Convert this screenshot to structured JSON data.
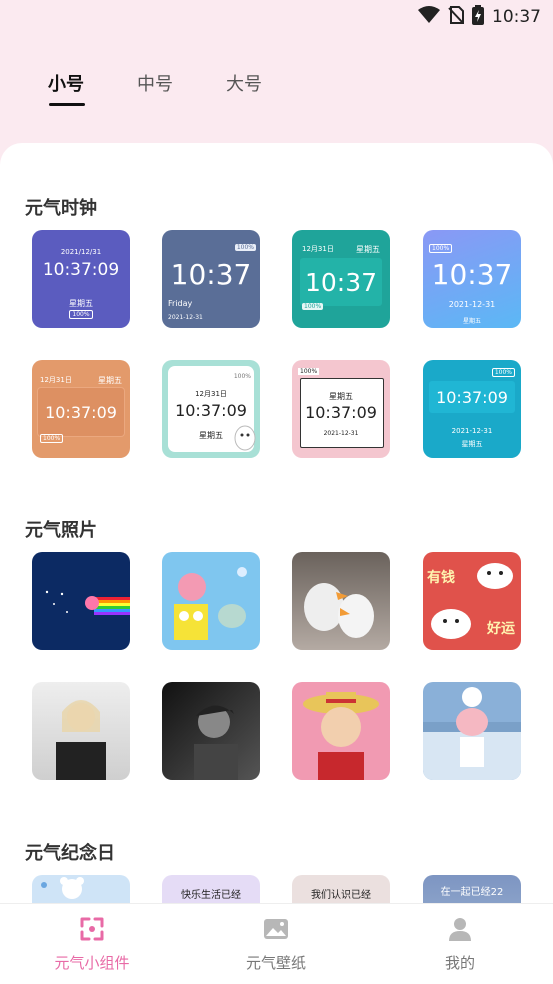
{
  "status": {
    "time": "10:37"
  },
  "tabs": [
    {
      "label": "小号"
    },
    {
      "label": "中号"
    },
    {
      "label": "大号"
    }
  ],
  "sections": {
    "clock": {
      "title": "元气时钟"
    },
    "photo": {
      "title": "元气照片"
    },
    "anniversary": {
      "title": "元气纪念日"
    }
  },
  "clock_tiles": [
    {
      "date": "2021/12/31",
      "time": "10:37:09",
      "weekday": "星期五",
      "battery": "100%",
      "bg": "#5b5cbf"
    },
    {
      "battery": "100%",
      "time": "10:37",
      "weekday": "Friday",
      "date": "2021-12-31",
      "bg": "#5a6e97"
    },
    {
      "date": "12月31日",
      "weekday": "星期五",
      "time": "10:37",
      "battery": "100%",
      "bg": "#1fa49a"
    },
    {
      "battery": "100%",
      "time": "10:37",
      "date": "2021-12-31",
      "weekday": "星期五",
      "bg": "#7ea0f7"
    },
    {
      "date": "12月31日",
      "weekday": "星期五",
      "time": "10:37:09",
      "battery": "100%",
      "bg": "#e39a6b"
    },
    {
      "battery": "100%",
      "date": "12月31日",
      "time": "10:37:09",
      "weekday": "星期五",
      "bg": "#a8e0d6"
    },
    {
      "battery": "100%",
      "weekday": "星期五",
      "time": "10:37:09",
      "date": "2021-12-31",
      "bg": "#f4c6cf"
    },
    {
      "battery": "100%",
      "time": "10:37:09",
      "date": "2021-12-31",
      "weekday": "星期五",
      "bg": "#1aa9c9"
    }
  ],
  "photo_tiles": [
    {
      "name": "space-nyan-cat",
      "bg": "#0c2a63"
    },
    {
      "name": "spongebob-patrick",
      "bg": "#7fc6ef"
    },
    {
      "name": "white-ducks",
      "bg": "#8a7a70"
    },
    {
      "name": "lucky-cows",
      "bg": "#e0524b",
      "text1": "有钱",
      "text2": "好运"
    },
    {
      "name": "girl-heart-hands",
      "bg": "#d9d9d9"
    },
    {
      "name": "boy-portrait-bw",
      "bg": "#2a2a2a"
    },
    {
      "name": "luffy",
      "bg": "#f19ab2"
    },
    {
      "name": "pig-chef",
      "bg": "#f0b8c4"
    }
  ],
  "anniversary_tiles": [
    {
      "text": "",
      "bg": "#cfe4f7"
    },
    {
      "text": "快乐生活已经",
      "bg": "#e5dcf6"
    },
    {
      "text": "我们认识已经",
      "bg": "#ebe0df"
    },
    {
      "text": "在一起已经22",
      "bg": "#93aacd"
    }
  ],
  "bottom_nav": [
    {
      "label": "元气小组件"
    },
    {
      "label": "元气壁纸"
    },
    {
      "label": "我的"
    }
  ],
  "colors": {
    "accent": "#e86aa6",
    "header_bg": "#fbeaf0"
  }
}
